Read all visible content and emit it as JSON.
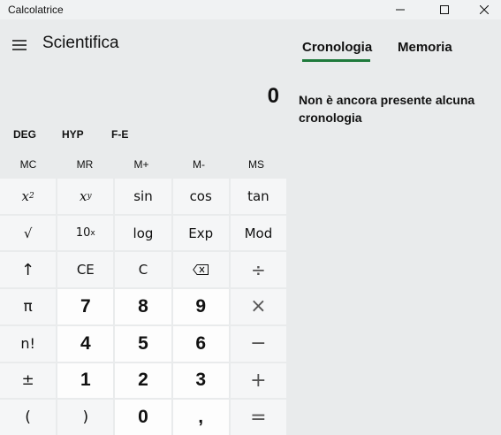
{
  "window": {
    "title": "Calcolatrice"
  },
  "header": {
    "mode": "Scientifica"
  },
  "display": {
    "value": "0"
  },
  "toggles": [
    "DEG",
    "HYP",
    "F-E"
  ],
  "memory": [
    "MC",
    "MR",
    "M+",
    "M-",
    "MS"
  ],
  "keys": {
    "x2_base": "x",
    "x2_exp": "2",
    "xy_base": "x",
    "xy_exp": "y",
    "sin": "sin",
    "cos": "cos",
    "tan": "tan",
    "sqrt": "√",
    "ten_base": "10",
    "ten_exp": "x",
    "log": "log",
    "exp": "Exp",
    "mod": "Mod",
    "up": "↑",
    "ce": "CE",
    "c": "C",
    "divide": "÷",
    "pi": "π",
    "n7": "7",
    "n8": "8",
    "n9": "9",
    "multiply": "×",
    "factorial": "n!",
    "n4": "4",
    "n5": "5",
    "n6": "6",
    "minus": "−",
    "plusminus": "±",
    "n1": "1",
    "n2": "2",
    "n3": "3",
    "plus": "+",
    "lparen": "(",
    "rparen": ")",
    "n0": "0",
    "comma": ",",
    "equals": "="
  },
  "side": {
    "tabs": [
      "Cronologia",
      "Memoria"
    ],
    "active_tab": "Cronologia",
    "history_message": "Non è ancora presente alcuna cronologia"
  },
  "colors": {
    "accent": "#1f7a3c",
    "background": "#e9ebec",
    "number_key": "#fdfdfd",
    "function_key": "#f5f6f7"
  },
  "icons": [
    "minimize-icon",
    "maximize-icon",
    "close-icon",
    "hamburger-icon",
    "backspace-icon"
  ]
}
